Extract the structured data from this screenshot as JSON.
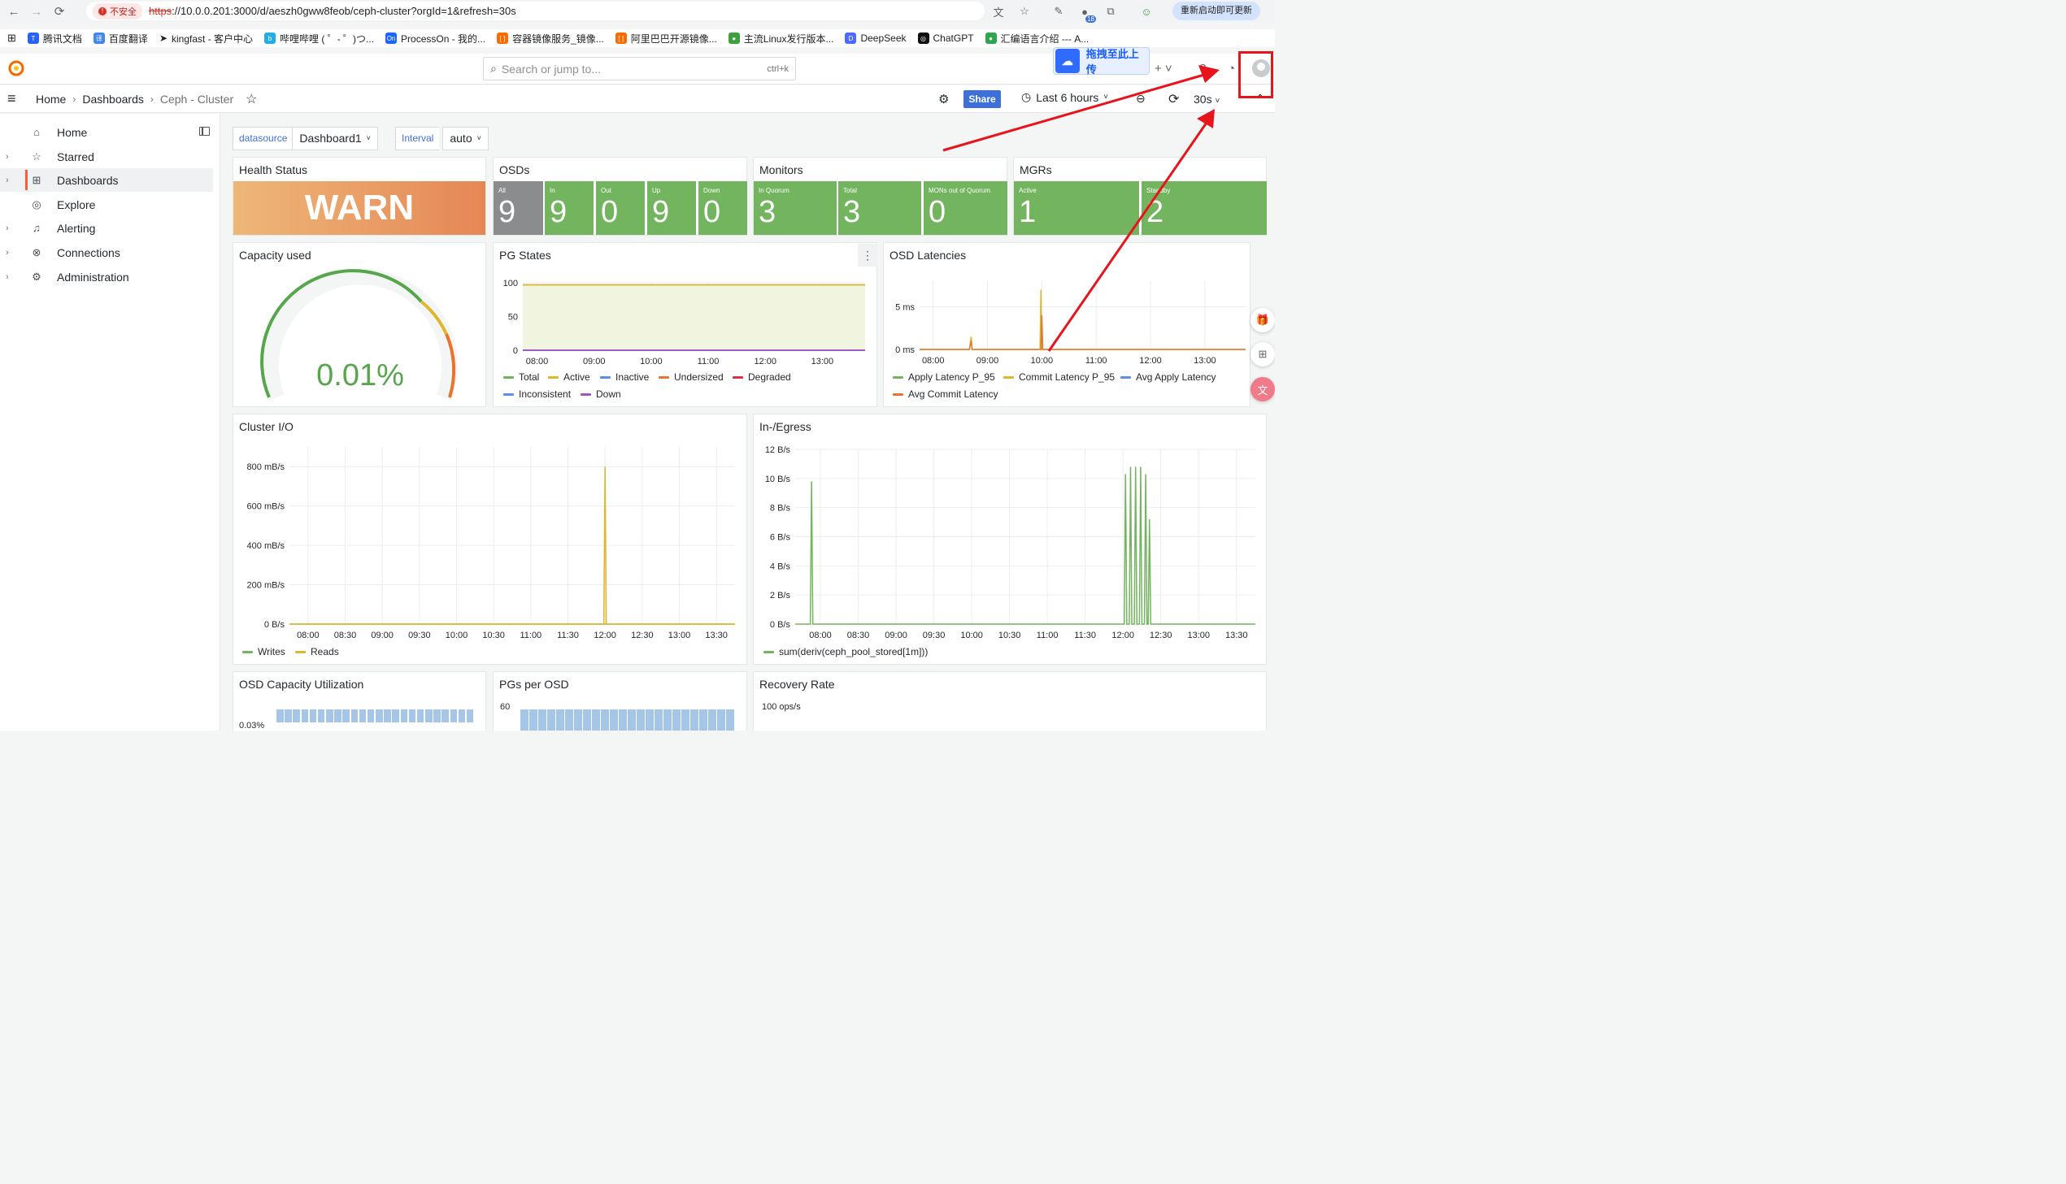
{
  "browser": {
    "insecure_label": "不安全",
    "url_proto": "https",
    "url_rest": "://10.0.0.201:3000/d/aeszh0gww8feob/ceph-cluster?orgId=1&refresh=30s",
    "update_label": "重新启动即可更新",
    "ext_badge": "18"
  },
  "bookmarks": [
    "腾讯文档",
    "百度翻译",
    "kingfast - 客户中心",
    "哔哩哔哩 ( ゜- ゜)つ...",
    "ProcessOn - 我的...",
    "容器镜像服务_镜像...",
    "阿里巴巴开源镜像...",
    "主流Linux发行版本...",
    "DeepSeek",
    "ChatGPT",
    "汇编语言介绍 --- A..."
  ],
  "topbar": {
    "search_placeholder": "Search or jump to...",
    "search_kbd": "ctrl+k",
    "upload_label": "拖拽至此上传"
  },
  "breadcrumb": {
    "home": "Home",
    "dashboards": "Dashboards",
    "current": "Ceph - Cluster"
  },
  "toolbar": {
    "share": "Share",
    "time_range": "Last 6 hours",
    "refresh": "30s"
  },
  "sidebar": [
    {
      "label": "Home",
      "icon": "home-icon"
    },
    {
      "label": "Starred",
      "icon": "star-icon"
    },
    {
      "label": "Dashboards",
      "icon": "dashboards-icon"
    },
    {
      "label": "Explore",
      "icon": "explore-icon"
    },
    {
      "label": "Alerting",
      "icon": "bell-icon"
    },
    {
      "label": "Connections",
      "icon": "connections-icon"
    },
    {
      "label": "Administration",
      "icon": "gear-icon"
    }
  ],
  "variables": {
    "datasource_label": "datasource",
    "datasource_value": "Dashboard1",
    "interval_label": "Interval",
    "interval_value": "auto"
  },
  "panels": {
    "health": {
      "title": "Health Status",
      "value": "WARN"
    },
    "osds": {
      "title": "OSDs",
      "stats": [
        {
          "label": "All",
          "value": "9"
        },
        {
          "label": "In",
          "value": "9"
        },
        {
          "label": "Out",
          "value": "0"
        },
        {
          "label": "Up",
          "value": "9"
        },
        {
          "label": "Down",
          "value": "0"
        }
      ]
    },
    "monitors": {
      "title": "Monitors",
      "stats": [
        {
          "label": "In Quorum",
          "value": "3"
        },
        {
          "label": "Total",
          "value": "3"
        },
        {
          "label": "MONs out of Quorum",
          "value": "0"
        }
      ]
    },
    "mgrs": {
      "title": "MGRs",
      "stats": [
        {
          "label": "Active",
          "value": "1"
        },
        {
          "label": "Standby",
          "value": "2"
        }
      ]
    },
    "capacity": {
      "title": "Capacity used",
      "value": "0.01%",
      "fraction": 0.0001
    },
    "pg_states": {
      "title": "PG States",
      "legend": [
        "Total",
        "Active",
        "Inactive",
        "Undersized",
        "Degraded",
        "Inconsistent",
        "Down"
      ]
    },
    "osd_latencies": {
      "title": "OSD Latencies",
      "legend": [
        "Apply Latency P_95",
        "Commit Latency P_95",
        "Avg Apply Latency",
        "Avg Commit Latency"
      ]
    },
    "cluster_io": {
      "title": "Cluster I/O",
      "legend": [
        "Writes",
        "Reads"
      ]
    },
    "inegress": {
      "title": "In-/Egress",
      "legend": [
        "sum(deriv(ceph_pool_stored[1m]))"
      ]
    },
    "osd_capacity": {
      "title": "OSD Capacity Utilization",
      "tick": "0.03%"
    },
    "pgs_per_osd": {
      "title": "PGs per OSD",
      "tick": "60"
    },
    "recovery": {
      "title": "Recovery Rate",
      "tick": "100 ops/s"
    }
  },
  "colors": {
    "green": "#73b45f",
    "yellow": "#e0b62d",
    "blue": "#5a8dee",
    "orange": "#e8742d",
    "red": "#e02f44",
    "purple": "#a352cc",
    "warn_start": "#eeb777",
    "warn_end": "#e58755"
  },
  "chart_data": [
    {
      "type": "line",
      "title": "PG States",
      "x": [
        "08:00",
        "09:00",
        "10:00",
        "11:00",
        "12:00",
        "13:00"
      ],
      "ylim": [
        0,
        100
      ],
      "yticks": [
        "0",
        "50",
        "100"
      ],
      "series": [
        {
          "name": "Total",
          "values": [
            97,
            97,
            97,
            97,
            97,
            97
          ]
        },
        {
          "name": "Active",
          "values": [
            97,
            97,
            97,
            97,
            97,
            97
          ]
        },
        {
          "name": "Inactive",
          "values": [
            0,
            0,
            0,
            0,
            0,
            0
          ]
        },
        {
          "name": "Undersized",
          "values": [
            0,
            0,
            0,
            0,
            0,
            0
          ]
        },
        {
          "name": "Degraded",
          "values": [
            0,
            0,
            0,
            0,
            0,
            0
          ]
        },
        {
          "name": "Inconsistent",
          "values": [
            0,
            0,
            0,
            0,
            0,
            0
          ]
        },
        {
          "name": "Down",
          "values": [
            0,
            0,
            0,
            0,
            0,
            0
          ]
        }
      ]
    },
    {
      "type": "line",
      "title": "OSD Latencies",
      "x": [
        "08:00",
        "09:00",
        "10:00",
        "11:00",
        "12:00",
        "13:00"
      ],
      "yticks": [
        "0 ms",
        "5 ms"
      ],
      "ylim": [
        0,
        8
      ],
      "series": [
        {
          "name": "Apply Latency P_95",
          "x": [],
          "values": []
        },
        {
          "name": "Commit Latency P_95",
          "x": [
            "08:40",
            "08:42",
            "08:43",
            "08:44",
            "09:58",
            "09:59",
            "10:00",
            "10:01"
          ],
          "values": [
            0,
            1.5,
            0,
            0,
            0,
            7,
            0,
            0
          ]
        },
        {
          "name": "Avg Apply Latency",
          "x": [],
          "values": []
        },
        {
          "name": "Avg Commit Latency",
          "x": [
            "08:40",
            "08:42",
            "08:43",
            "09:59",
            "10:00",
            "10:01"
          ],
          "values": [
            0,
            1,
            0,
            0,
            4,
            0
          ]
        }
      ]
    },
    {
      "type": "line",
      "title": "Cluster I/O",
      "x": [
        "08:00",
        "08:30",
        "09:00",
        "09:30",
        "10:00",
        "10:30",
        "11:00",
        "11:30",
        "12:00",
        "12:30",
        "13:00",
        "13:30"
      ],
      "yticks": [
        "0 B/s",
        "200 mB/s",
        "400 mB/s",
        "600 mB/s",
        "800 mB/s"
      ],
      "ylim": [
        0,
        900
      ],
      "series": [
        {
          "name": "Writes",
          "values": [
            0,
            0,
            0,
            0,
            0,
            0,
            0,
            0,
            0,
            0,
            0,
            0
          ]
        },
        {
          "name": "Reads",
          "x": [
            "11:59",
            "12:00",
            "12:01"
          ],
          "values": [
            0,
            800,
            0
          ]
        }
      ]
    },
    {
      "type": "line",
      "title": "In-/Egress",
      "x": [
        "08:00",
        "08:30",
        "09:00",
        "09:30",
        "10:00",
        "10:30",
        "11:00",
        "11:30",
        "12:00",
        "12:30",
        "13:00",
        "13:30"
      ],
      "yticks": [
        "0 B/s",
        "2 B/s",
        "4 B/s",
        "6 B/s",
        "8 B/s",
        "10 B/s",
        "12 B/s"
      ],
      "ylim": [
        0,
        12
      ],
      "series": [
        {
          "name": "sum(deriv(ceph_pool_stored[1m]))",
          "x": [
            "07:52",
            "07:53",
            "07:54",
            "12:01",
            "12:02",
            "12:03",
            "12:05",
            "12:06",
            "12:07",
            "12:09",
            "12:10",
            "12:11",
            "12:13",
            "12:14",
            "12:15",
            "12:17",
            "12:18",
            "12:19",
            "12:20",
            "12:21",
            "12:22"
          ],
          "values": [
            0,
            9.8,
            0,
            0,
            10.3,
            0,
            0,
            10.8,
            0,
            0,
            10.8,
            0,
            0,
            10.8,
            0,
            0,
            10.3,
            0,
            0,
            7.2,
            0
          ]
        }
      ]
    }
  ]
}
